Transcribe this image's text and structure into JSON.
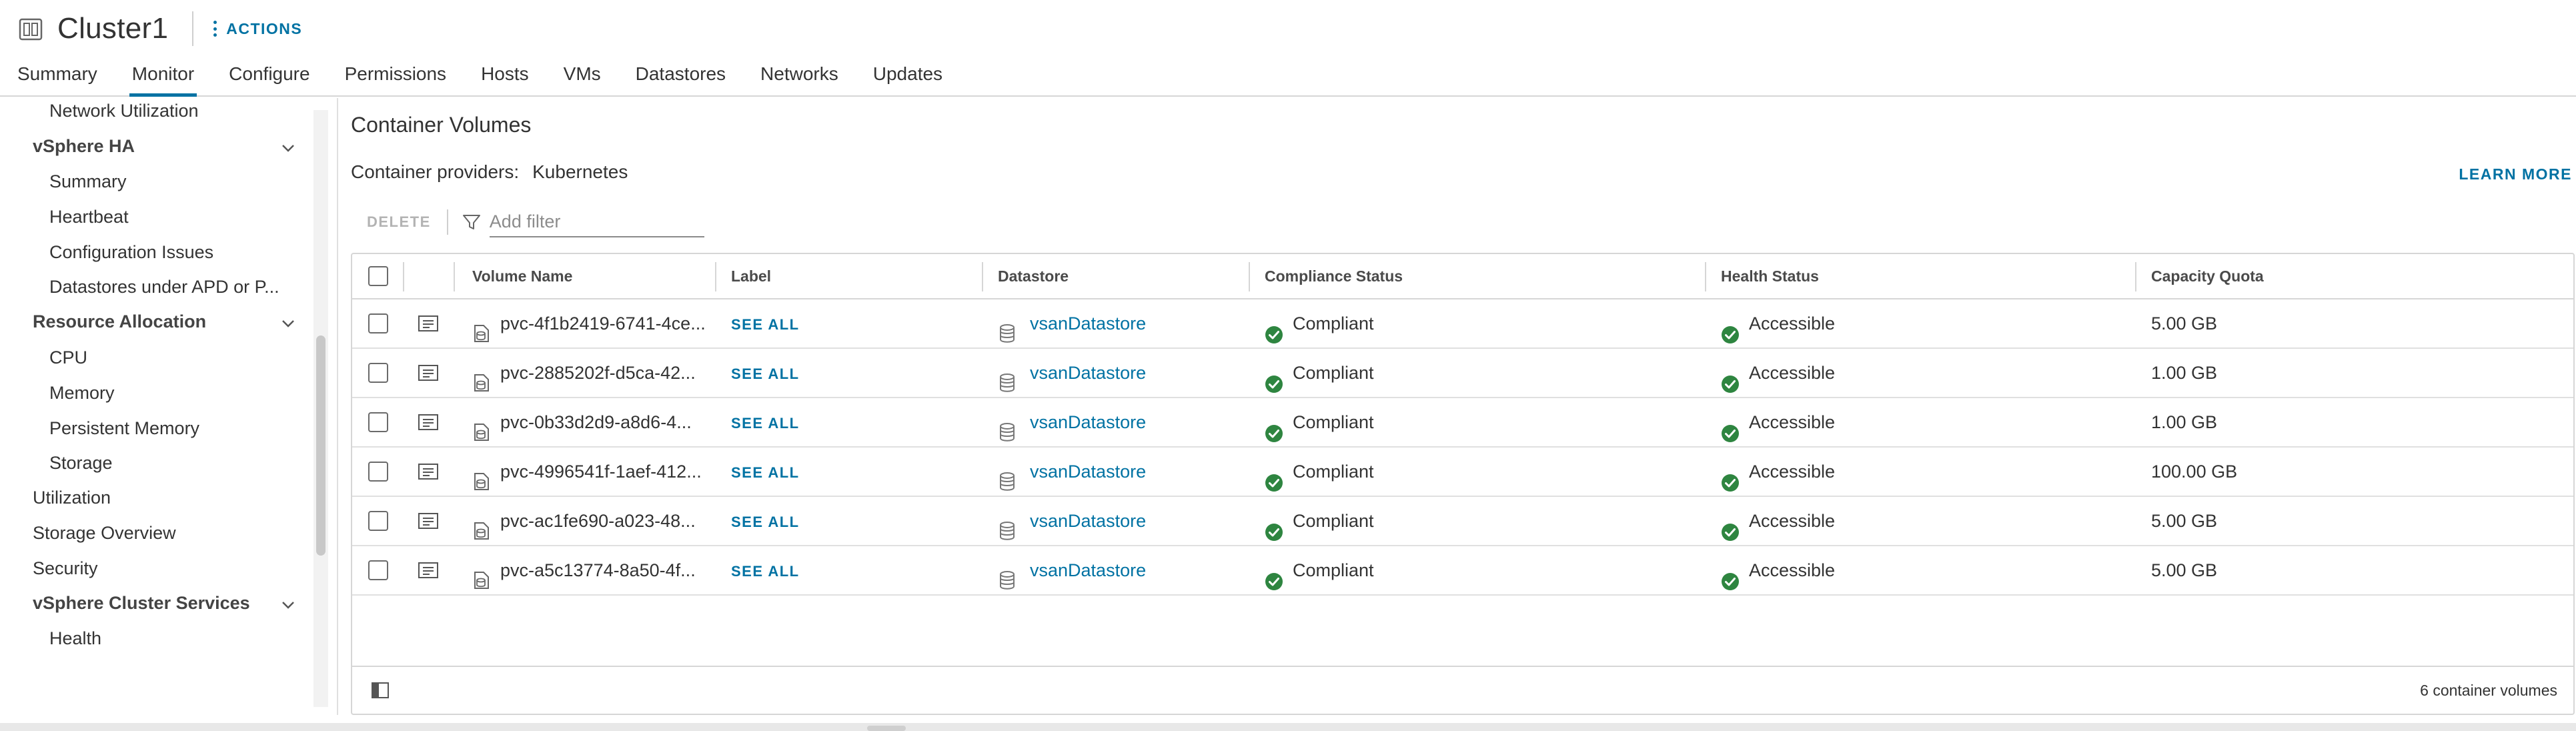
{
  "header": {
    "title": "Cluster1",
    "actions_label": "ACTIONS",
    "tabs": [
      {
        "label": "Summary",
        "active": false
      },
      {
        "label": "Monitor",
        "active": true
      },
      {
        "label": "Configure",
        "active": false
      },
      {
        "label": "Permissions",
        "active": false
      },
      {
        "label": "Hosts",
        "active": false
      },
      {
        "label": "VMs",
        "active": false
      },
      {
        "label": "Datastores",
        "active": false
      },
      {
        "label": "Networks",
        "active": false
      },
      {
        "label": "Updates",
        "active": false
      }
    ]
  },
  "sidebar": {
    "items": [
      {
        "label": "Network Utilization",
        "level": 2
      },
      {
        "label": "vSphere HA",
        "level": "group",
        "expanded": true
      },
      {
        "label": "Summary",
        "level": 2
      },
      {
        "label": "Heartbeat",
        "level": 2
      },
      {
        "label": "Configuration Issues",
        "level": 2
      },
      {
        "label": "Datastores under APD or P...",
        "level": 2
      },
      {
        "label": "Resource Allocation",
        "level": "group",
        "expanded": true
      },
      {
        "label": "CPU",
        "level": 2
      },
      {
        "label": "Memory",
        "level": 2
      },
      {
        "label": "Persistent Memory",
        "level": 2
      },
      {
        "label": "Storage",
        "level": 2
      },
      {
        "label": "Utilization",
        "level": 1
      },
      {
        "label": "Storage Overview",
        "level": 1
      },
      {
        "label": "Security",
        "level": 1
      },
      {
        "label": "vSphere Cluster Services",
        "level": "group",
        "expanded": true
      },
      {
        "label": "Health",
        "level": 2
      }
    ]
  },
  "main": {
    "section_title": "Container Volumes",
    "providers_label": "Container providers:",
    "providers_value": "Kubernetes",
    "learn_more": "LEARN MORE",
    "delete_label": "DELETE",
    "filter_placeholder": "Add filter",
    "columns": [
      "Volume Name",
      "Label",
      "Datastore",
      "Compliance Status",
      "Health Status",
      "Capacity Quota"
    ],
    "rows": [
      {
        "volume": "pvc-4f1b2419-6741-4ce...",
        "label": "SEE ALL",
        "datastore": "vsanDatastore",
        "compliance": "Compliant",
        "health": "Accessible",
        "capacity": "5.00 GB"
      },
      {
        "volume": "pvc-2885202f-d5ca-42...",
        "label": "SEE ALL",
        "datastore": "vsanDatastore",
        "compliance": "Compliant",
        "health": "Accessible",
        "capacity": "1.00 GB"
      },
      {
        "volume": "pvc-0b33d2d9-a8d6-4...",
        "label": "SEE ALL",
        "datastore": "vsanDatastore",
        "compliance": "Compliant",
        "health": "Accessible",
        "capacity": "1.00 GB"
      },
      {
        "volume": "pvc-4996541f-1aef-412...",
        "label": "SEE ALL",
        "datastore": "vsanDatastore",
        "compliance": "Compliant",
        "health": "Accessible",
        "capacity": "100.00 GB"
      },
      {
        "volume": "pvc-ac1fe690-a023-48...",
        "label": "SEE ALL",
        "datastore": "vsanDatastore",
        "compliance": "Compliant",
        "health": "Accessible",
        "capacity": "5.00 GB"
      },
      {
        "volume": "pvc-a5c13774-8a50-4f...",
        "label": "SEE ALL",
        "datastore": "vsanDatastore",
        "compliance": "Compliant",
        "health": "Accessible",
        "capacity": "5.00 GB"
      }
    ],
    "footer_count": "6 container volumes"
  },
  "colors": {
    "accent": "#0072a3",
    "success": "#2e8540",
    "text": "#333333",
    "border": "#d6d6d6"
  },
  "icons": [
    "cluster-icon",
    "actions-dots-icon",
    "chevron-down-icon",
    "filter-icon",
    "row-detail-icon",
    "volume-icon",
    "datastore-icon",
    "check-circle-icon",
    "column-toggle-icon"
  ]
}
